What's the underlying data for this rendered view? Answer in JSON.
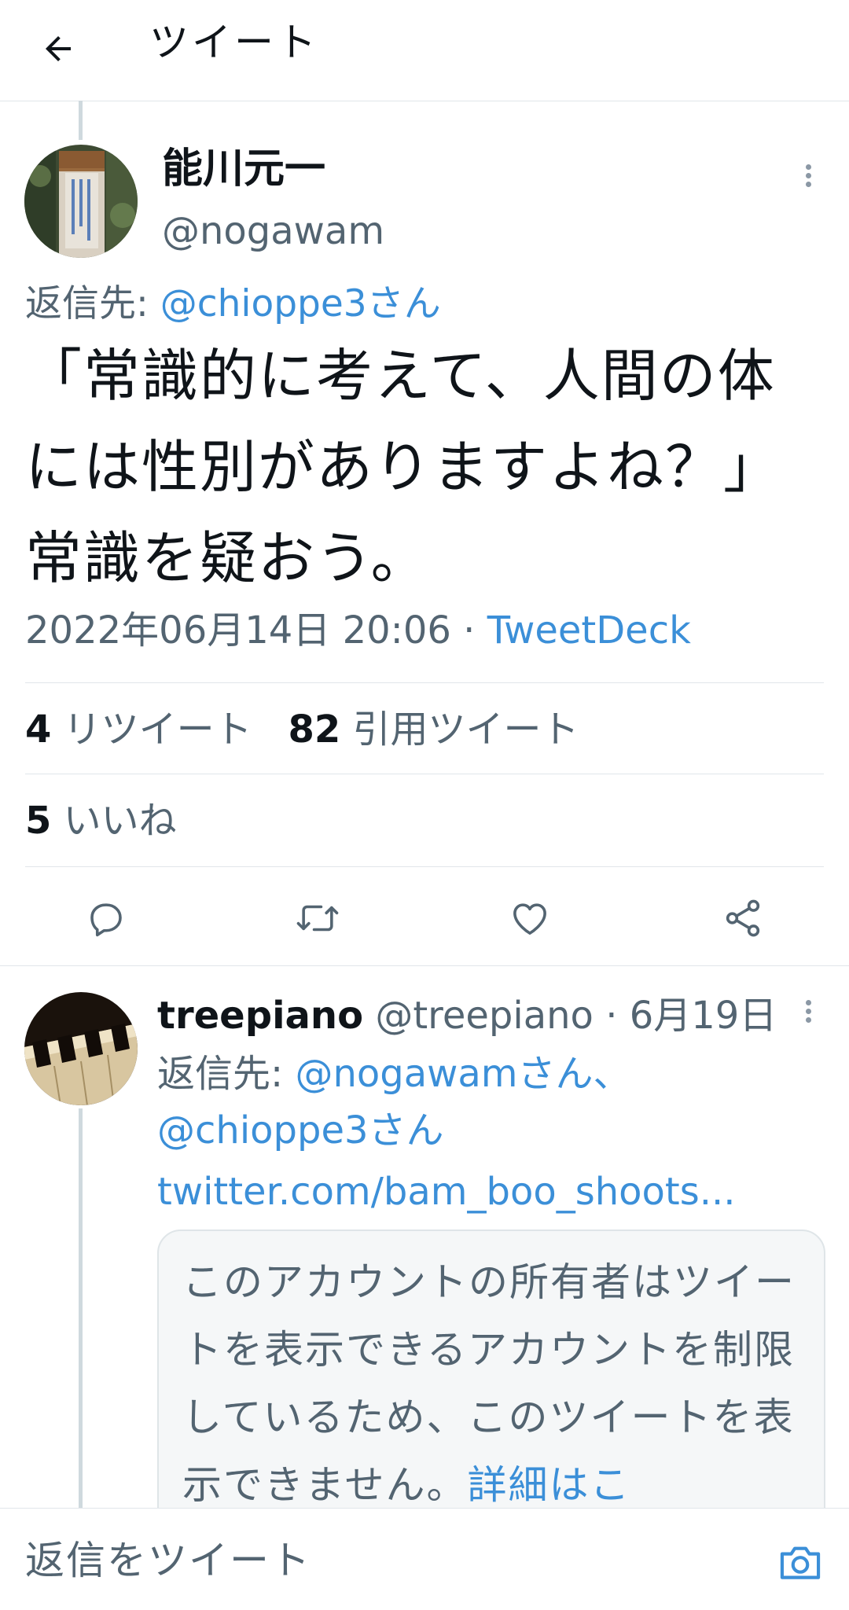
{
  "header": {
    "title": "ツイート"
  },
  "tweet": {
    "author_name": "能川元一",
    "author_handle": "@nogawam",
    "reply_to_label": "返信先: ",
    "reply_to_user": "@chioppe3さん",
    "text": "「常識的に考えて、人間の体には性別がありますよね？」常識を疑おう。",
    "timestamp": "2022年06月14日 20:06 · ",
    "source": "TweetDeck",
    "retweets_count": "4",
    "retweets_label": "リツイート",
    "quotes_count": "82",
    "quotes_label": "引用ツイート",
    "likes_count": "5",
    "likes_label": "いいね"
  },
  "actions": [
    "reply-icon",
    "retweet-icon",
    "like-icon",
    "share-icon"
  ],
  "reply": {
    "author_name": "treepiano",
    "author_handle": "@treepiano",
    "date": "· 6月19日",
    "reply_to_label": "返信先: ",
    "reply_to_user1": "@nogawamさん、",
    "reply_to_user2": "@chioppe3さん",
    "link": "twitter.com/bam_boo_shoots...",
    "quote_notice": "このアカウントの所有者はツイートを表示できるアカウントを制限しているため、このツイートを表示できません。",
    "quote_link": "詳細はこ"
  },
  "compose": {
    "placeholder": "返信をツイート"
  },
  "colors": {
    "link": "#3b8fd8",
    "secondary_text": "#536471",
    "divider": "#e1e6ea"
  }
}
